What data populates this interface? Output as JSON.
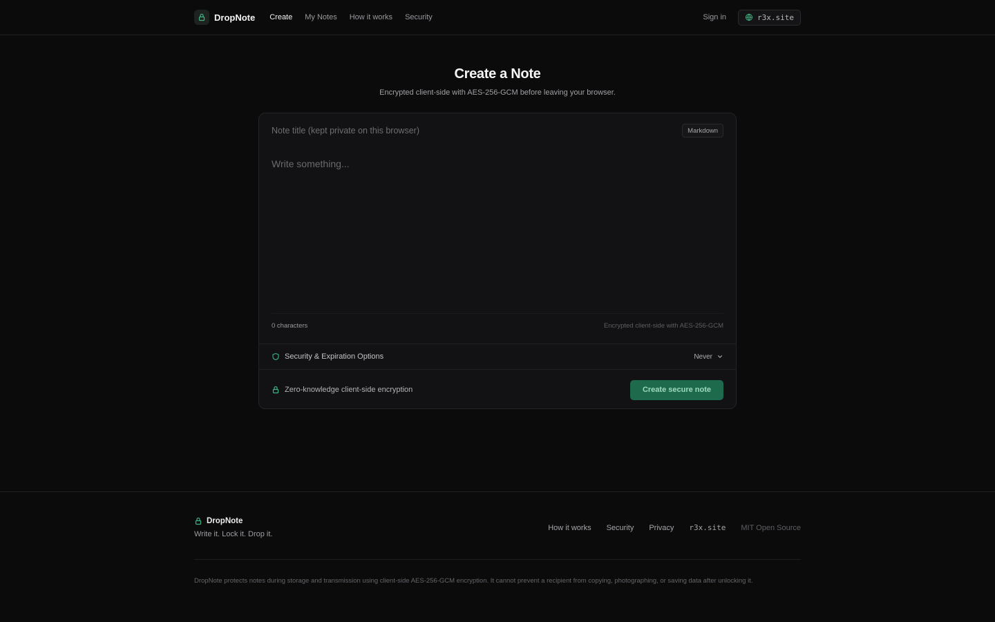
{
  "colors": {
    "background": "#0b0b0c",
    "accent": "#1d6a4c",
    "accent_text": "#9fd9bd",
    "icon_green": "#3fb384"
  },
  "header": {
    "brand": "DropNote",
    "logo_icon": "lock-icon",
    "nav": [
      {
        "label": "Create",
        "active": true
      },
      {
        "label": "My Notes",
        "active": false
      },
      {
        "label": "How it works",
        "active": false
      },
      {
        "label": "Security",
        "active": false
      }
    ],
    "sign_in": "Sign in",
    "site_chip": {
      "icon": "globe-icon",
      "label": "r3x.site"
    }
  },
  "main": {
    "title": "Create a Note",
    "subtitle": "Encrypted client-side with AES-256-GCM before leaving your browser."
  },
  "editor": {
    "title_placeholder": "Note title (kept private on this browser)",
    "title_value": "",
    "format_badge": "Markdown",
    "body_placeholder": "Write something...",
    "body_value": "",
    "char_count": "0 characters",
    "encryption_note": "Encrypted client-side with AES-256-GCM"
  },
  "options": {
    "icon": "shield-icon",
    "label": "Security & Expiration Options",
    "expiry_value": "Never",
    "expiry_icon": "chevron-down-icon"
  },
  "actions": {
    "zk_icon": "lock-icon",
    "zk_label": "Zero-knowledge client-side encryption",
    "create_label": "Create secure note"
  },
  "footer": {
    "brand": "DropNote",
    "tagline": "Write it. Lock it. Drop it.",
    "links": [
      "How it works",
      "Security",
      "Privacy",
      "r3x.site",
      "MIT Open Source"
    ],
    "disclaimer": "DropNote protects notes during storage and transmission using client-side AES-256-GCM encryption. It cannot prevent a recipient from copying, photographing, or saving data after unlocking it."
  }
}
